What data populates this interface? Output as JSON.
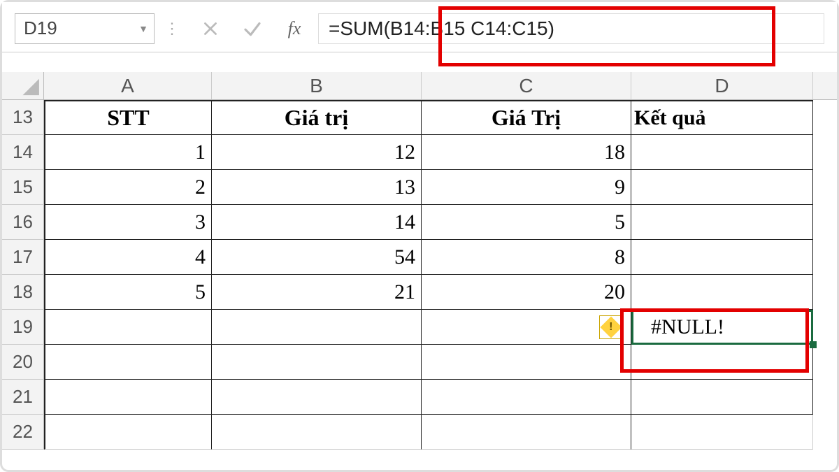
{
  "namebox": {
    "value": "D19"
  },
  "formula_bar": {
    "cancel_tip": "Cancel",
    "enter_tip": "Enter",
    "fx_label": "fx",
    "formula": "=SUM(B14:B15 C14:C15)"
  },
  "columns": [
    "A",
    "B",
    "C",
    "D"
  ],
  "row_headers": [
    "13",
    "14",
    "15",
    "16",
    "17",
    "18",
    "19",
    "20",
    "21",
    "22"
  ],
  "table": {
    "headers": {
      "A": "STT",
      "B": "Giá trị",
      "C": "Giá Trị",
      "D": "Kết quả"
    },
    "rows": [
      {
        "A": "1",
        "B": "12",
        "C": "18",
        "D": ""
      },
      {
        "A": "2",
        "B": "13",
        "C": "9",
        "D": ""
      },
      {
        "A": "3",
        "B": "14",
        "C": "5",
        "D": ""
      },
      {
        "A": "4",
        "B": "54",
        "C": "8",
        "D": ""
      },
      {
        "A": "5",
        "B": "21",
        "C": "20",
        "D": ""
      }
    ],
    "result_cell": {
      "ref": "D19",
      "value": "#NULL!"
    }
  },
  "error_indicator": {
    "tooltip": "Error in formula"
  },
  "highlights": {
    "formula_box": true,
    "result_box": true
  }
}
